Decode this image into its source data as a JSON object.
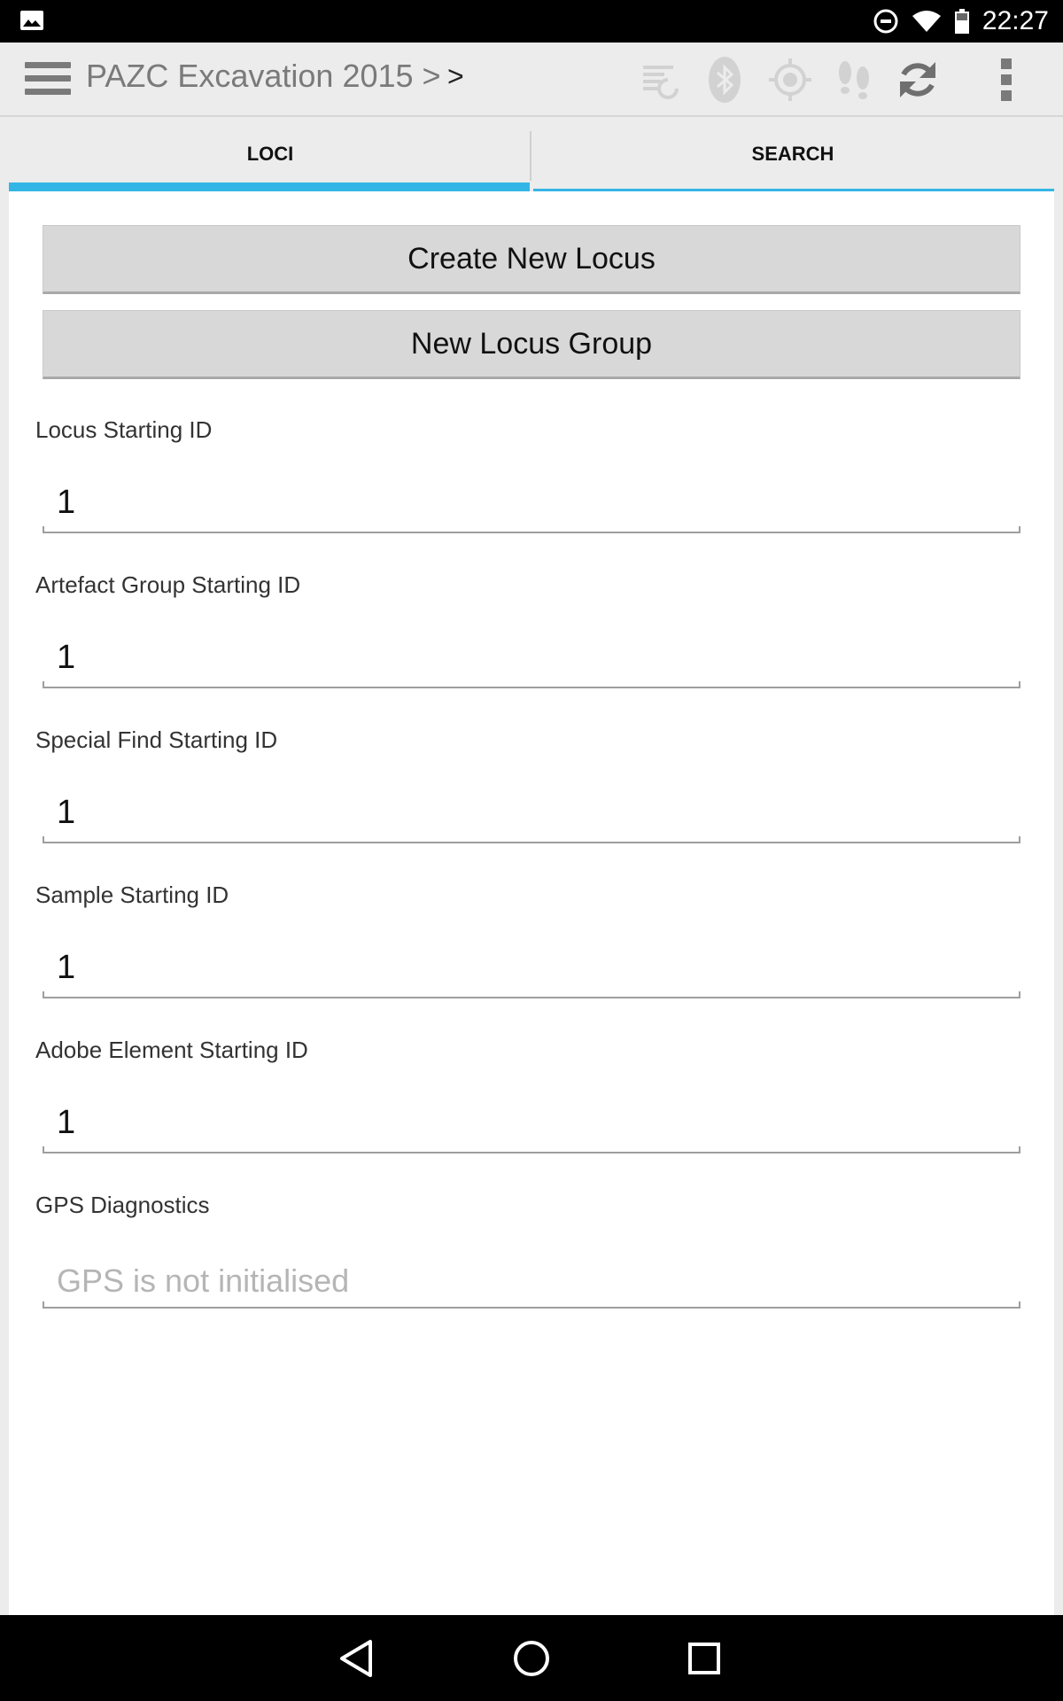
{
  "status_bar": {
    "time": "22:27",
    "icons": [
      "gallery-icon",
      "do-not-disturb-icon",
      "wifi-icon",
      "battery-icon"
    ]
  },
  "action_bar": {
    "title": "PAZC Excavation 2015 >",
    "breadcrumb_separator": ">",
    "icons": [
      "menu-icon",
      "sync-queue-icon",
      "bluetooth-icon",
      "gps-target-icon",
      "footsteps-icon",
      "refresh-icon",
      "overflow-menu-icon"
    ]
  },
  "tabs": [
    {
      "label": "LOCI",
      "selected": true
    },
    {
      "label": "SEARCH",
      "selected": false
    }
  ],
  "buttons": {
    "create_new_locus": "Create New Locus",
    "new_locus_group": "New Locus Group"
  },
  "fields": [
    {
      "label": "Locus Starting ID",
      "value": "1"
    },
    {
      "label": "Artefact Group Starting ID",
      "value": "1"
    },
    {
      "label": "Special Find Starting ID",
      "value": "1"
    },
    {
      "label": "Sample Starting ID",
      "value": "1"
    },
    {
      "label": "Adobe Element Starting ID",
      "value": "1"
    }
  ],
  "gps": {
    "label": "GPS Diagnostics",
    "placeholder": "GPS is not initialised"
  },
  "colors": {
    "accent": "#33b5e5",
    "action_bar_bg": "#ececec",
    "button_bg": "#d8d8d8"
  }
}
